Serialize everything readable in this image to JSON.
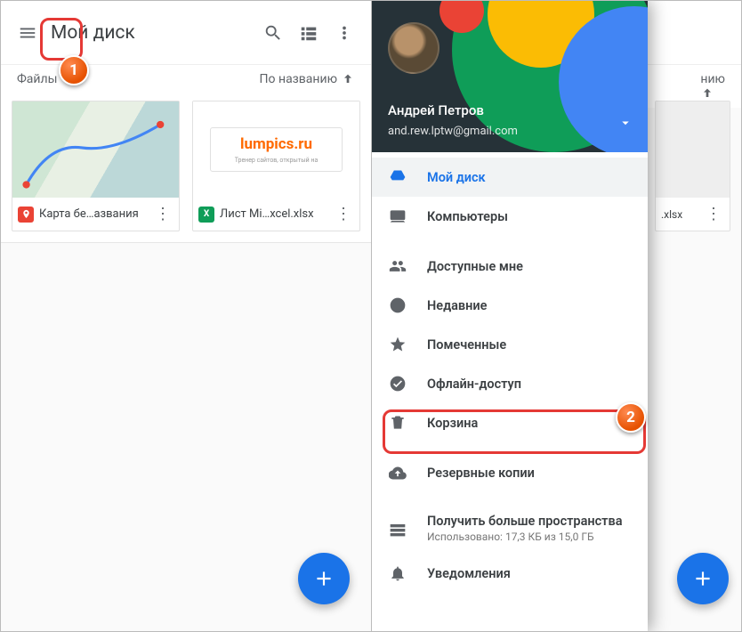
{
  "left": {
    "title": "Мой диск",
    "sort_left_label": "Файлы",
    "sort_label": "По названию",
    "files": [
      {
        "name": "Карта бе…азвания",
        "badge": "📍",
        "badge_bg": "#ea4335"
      },
      {
        "name": "Лист Mi…xcel.xlsx",
        "badge": "X",
        "badge_bg": "#0f9d58"
      }
    ],
    "lumpics_logo": "lumpics.ru",
    "lumpics_sub": "Тренер сайтов, открытый на"
  },
  "right": {
    "account_name": "Андрей Петров",
    "account_email": "and.rew.lptw@gmail.com",
    "bg_sort": "нию",
    "bg_filename": ".xlsx",
    "menu": {
      "my_drive": "Мой диск",
      "computers": "Компьютеры",
      "shared": "Доступные мне",
      "recent": "Недавние",
      "starred": "Помеченные",
      "offline": "Офлайн-доступ",
      "trash": "Корзина",
      "backups": "Резервные копии",
      "storage_title": "Получить больше пространства",
      "storage_sub": "Использовано: 17,3 КБ из 15,0 ГБ",
      "notifications": "Уведомления"
    }
  },
  "annotations": {
    "badge1": "1",
    "badge2": "2"
  }
}
